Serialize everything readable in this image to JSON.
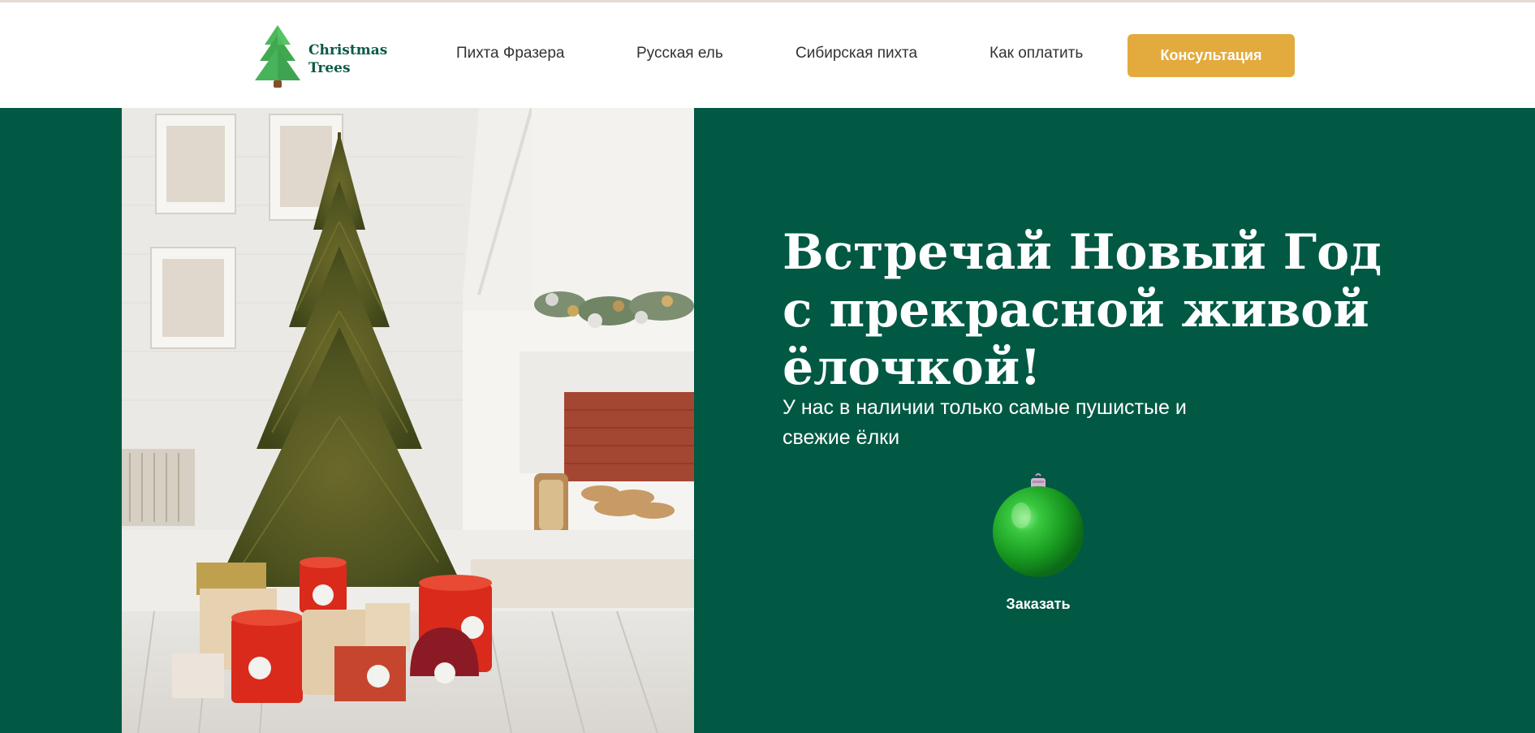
{
  "brand": {
    "logo_line1": "Christmas",
    "logo_line2": "Trees",
    "logo_icon": "christmas-tree-icon"
  },
  "nav": {
    "items": [
      {
        "label": "Пихта Фразера"
      },
      {
        "label": "Русская ель"
      },
      {
        "label": "Сибирская пихта"
      },
      {
        "label": "Как оплатить"
      }
    ],
    "cta_label": "Консультация"
  },
  "hero": {
    "title_lines": [
      "Встречай Новый Год",
      "с прекрасной живой",
      "ёлочкой!"
    ],
    "subtitle_lines": [
      "У нас в наличии только самые пушистые и",
      "свежие ёлки"
    ],
    "order_icon": "christmas-ornament-icon",
    "order_label": "Заказать"
  },
  "colors": {
    "hero_background": "#015944",
    "cta_background": "#e3ab3d",
    "logo_text": "#0a5a45",
    "nav_text": "#333333"
  }
}
